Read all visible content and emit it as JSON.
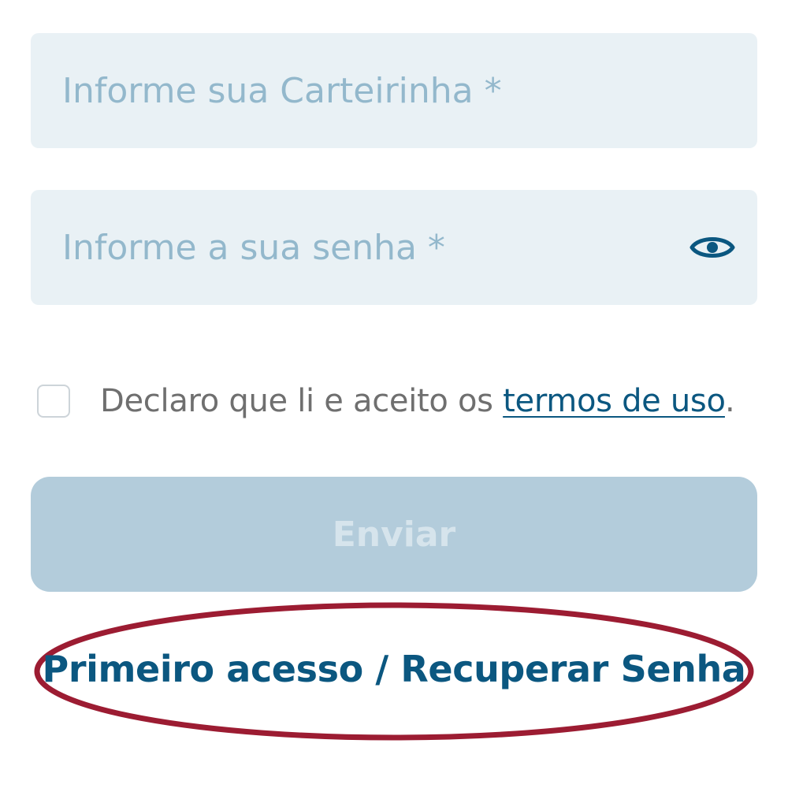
{
  "form": {
    "card_field": {
      "placeholder": "Informe sua Carteirinha *",
      "value": ""
    },
    "password_field": {
      "placeholder": "Informe a sua senha *",
      "value": "",
      "toggle_icon": "eye-icon"
    },
    "terms": {
      "checked": false,
      "text_before": "Declaro que li e aceito os ",
      "link_label": "termos de uso",
      "text_after": "."
    },
    "submit_label": "Enviar",
    "submit_enabled": false,
    "first_access_label": "Primeiro acesso / Recuperar Senha"
  },
  "colors": {
    "primary": "#0b5780",
    "field_bg": "#e9f1f5",
    "placeholder": "#93b8cc",
    "button_disabled_bg": "#b3ccdb",
    "button_disabled_text": "#d6e4ec",
    "annotation_ellipse": "#9c1c32"
  }
}
